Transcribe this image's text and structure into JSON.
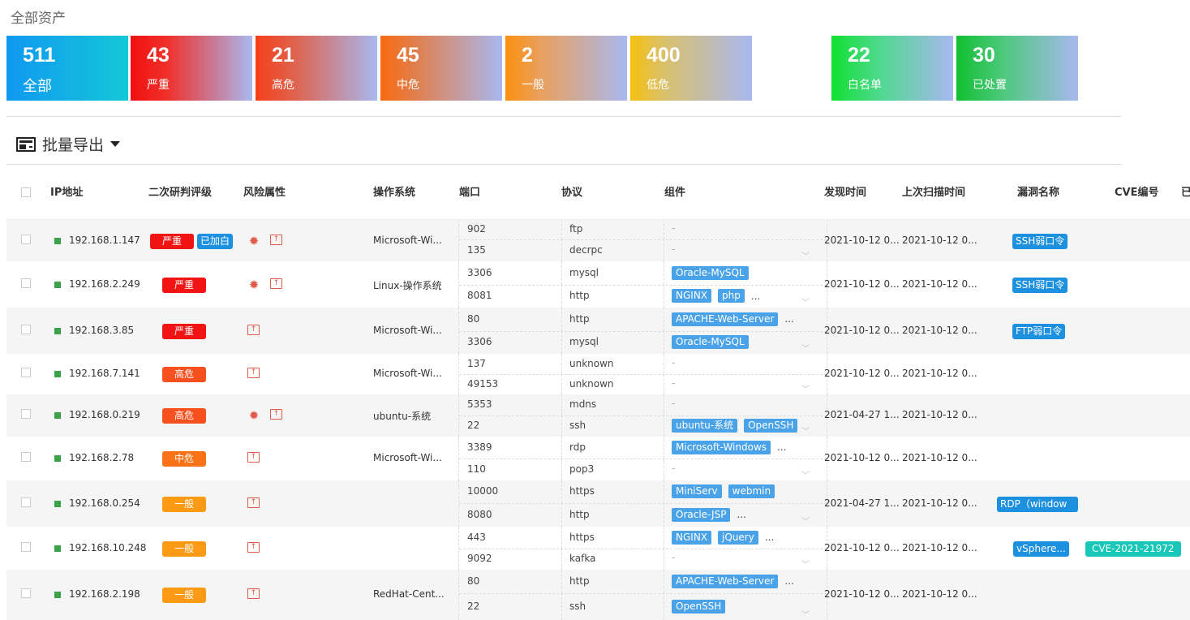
{
  "page_title": "全部资产",
  "cards": [
    {
      "num": "511",
      "label": "全部"
    },
    {
      "num": "43",
      "label": "严重"
    },
    {
      "num": "21",
      "label": "高危"
    },
    {
      "num": "45",
      "label": "中危"
    },
    {
      "num": "2",
      "label": "一般"
    },
    {
      "num": "400",
      "label": "低危"
    },
    {
      "num": "22",
      "label": "白名单"
    },
    {
      "num": "30",
      "label": "已处置"
    }
  ],
  "export_label": "批量导出",
  "headers": {
    "ip": "IP地址",
    "rating": "二次研判评级",
    "risk": "风险属性",
    "os": "操作系统",
    "port": "端口",
    "proto": "协议",
    "comp": "组件",
    "found": "发现时间",
    "scanned": "上次扫描时间",
    "vuln": "漏洞名称",
    "cve": "CVE编号",
    "extra": "已"
  },
  "rows": [
    {
      "ip": "192.168.1.147",
      "level": "严重",
      "wl": "已加白",
      "os": "Microsoft-Wi...",
      "found": "2021-10-12 0...",
      "scanned": "2021-10-12 0...",
      "vuln": "SSH弱口令",
      "cve": "",
      "subs": [
        {
          "port": "902",
          "proto": "ftp",
          "tags": [],
          "more": "",
          "dash": "-"
        },
        {
          "port": "135",
          "proto": "decrpc",
          "tags": [],
          "more": "",
          "dash": "-"
        }
      ]
    },
    {
      "ip": "192.168.2.249",
      "level": "严重",
      "wl": "",
      "os": "Linux-操作系统",
      "found": "2021-10-12 0...",
      "scanned": "2021-10-12 0...",
      "vuln": "SSH弱口令",
      "cve": "",
      "subs": [
        {
          "port": "3306",
          "proto": "mysql",
          "tags": [
            "Oracle-MySQL"
          ],
          "more": "",
          "dash": ""
        },
        {
          "port": "8081",
          "proto": "http",
          "tags": [
            "NGINX",
            "php"
          ],
          "more": "...",
          "dash": ""
        }
      ]
    },
    {
      "ip": "192.168.3.85",
      "level": "严重",
      "wl": "",
      "os": "Microsoft-Wi...",
      "found": "2021-10-12 0...",
      "scanned": "2021-10-12 0...",
      "vuln": "FTP弱口令",
      "cve": "",
      "subs": [
        {
          "port": "80",
          "proto": "http",
          "tags": [
            "APACHE-Web-Server"
          ],
          "more": "...",
          "dash": ""
        },
        {
          "port": "3306",
          "proto": "mysql",
          "tags": [
            "Oracle-MySQL"
          ],
          "more": "",
          "dash": ""
        }
      ]
    },
    {
      "ip": "192.168.7.141",
      "level": "高危",
      "wl": "",
      "os": "Microsoft-Wi...",
      "found": "2021-10-12 0...",
      "scanned": "2021-10-12 0...",
      "vuln": "",
      "cve": "",
      "subs": [
        {
          "port": "137",
          "proto": "unknown",
          "tags": [],
          "more": "",
          "dash": "-"
        },
        {
          "port": "49153",
          "proto": "unknown",
          "tags": [],
          "more": "",
          "dash": "-"
        }
      ]
    },
    {
      "ip": "192.168.0.219",
      "level": "高危",
      "wl": "",
      "os": "ubuntu-系统",
      "found": "2021-04-27 1...",
      "scanned": "2021-10-12 0...",
      "vuln": "",
      "cve": "",
      "subs": [
        {
          "port": "5353",
          "proto": "mdns",
          "tags": [],
          "more": "",
          "dash": "-"
        },
        {
          "port": "22",
          "proto": "ssh",
          "tags": [
            "ubuntu-系统",
            "OpenSSH"
          ],
          "more": "",
          "dash": ""
        }
      ]
    },
    {
      "ip": "192.168.2.78",
      "level": "中危",
      "wl": "",
      "os": "Microsoft-Wi...",
      "found": "2021-10-12 0...",
      "scanned": "2021-10-12 0...",
      "vuln": "",
      "cve": "",
      "subs": [
        {
          "port": "3389",
          "proto": "rdp",
          "tags": [
            "Microsoft-Windows"
          ],
          "more": "...",
          "dash": ""
        },
        {
          "port": "110",
          "proto": "pop3",
          "tags": [],
          "more": "",
          "dash": "-"
        }
      ]
    },
    {
      "ip": "192.168.0.254",
      "level": "一般",
      "wl": "",
      "os": "",
      "found": "2021-04-27 1...",
      "scanned": "2021-10-12 0...",
      "vuln": "RDP（window",
      "cve": "",
      "subs": [
        {
          "port": "10000",
          "proto": "https",
          "tags": [
            "MiniServ",
            "webmin"
          ],
          "more": "",
          "dash": ""
        },
        {
          "port": "8080",
          "proto": "http",
          "tags": [
            "Oracle-JSP"
          ],
          "more": "...",
          "dash": ""
        }
      ]
    },
    {
      "ip": "192.168.10.248",
      "level": "一般",
      "wl": "",
      "os": "",
      "found": "2021-10-12 0...",
      "scanned": "2021-10-12 0...",
      "vuln": "vSphere...",
      "cve": "CVE-2021-21972",
      "subs": [
        {
          "port": "443",
          "proto": "https",
          "tags": [
            "NGINX",
            "jQuery"
          ],
          "more": "...",
          "dash": ""
        },
        {
          "port": "9092",
          "proto": "kafka",
          "tags": [],
          "more": "",
          "dash": "-"
        }
      ]
    },
    {
      "ip": "192.168.2.198",
      "level": "一般",
      "wl": "",
      "os": "RedHat-Cent...",
      "found": "2021-10-12 0...",
      "scanned": "2021-10-12 0...",
      "vuln": "",
      "cve": "",
      "subs": [
        {
          "port": "80",
          "proto": "http",
          "tags": [
            "APACHE-Web-Server"
          ],
          "more": "...",
          "dash": ""
        },
        {
          "port": "22",
          "proto": "ssh",
          "tags": [
            "OpenSSH"
          ],
          "more": "",
          "dash": ""
        }
      ]
    }
  ],
  "colors": {
    "critical": "#f01414",
    "high": "#f5501e",
    "medium": "#f97316",
    "low": "#fb9a14",
    "whitelist": "#1e90e0",
    "tag": "#4aa3e8",
    "cve": "#19c7b8"
  }
}
